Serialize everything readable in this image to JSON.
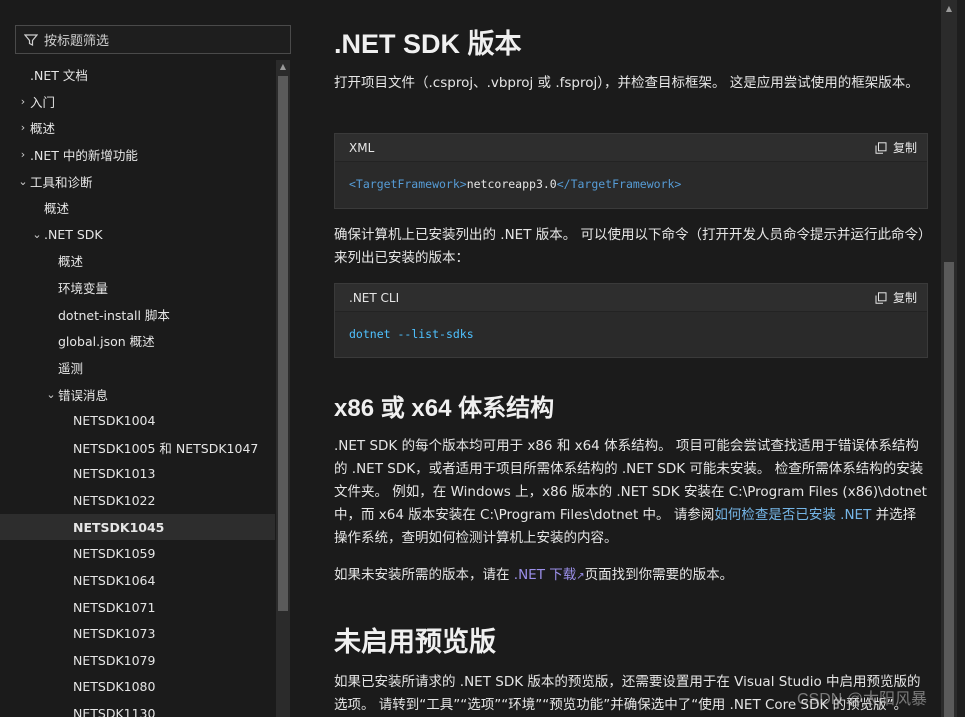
{
  "nav": {
    "filter_placeholder": "按标题筛选",
    "items": [
      {
        "label": ".NET 文档",
        "chevron": ""
      },
      {
        "label": "入门",
        "chevron": "›"
      },
      {
        "label": "概述",
        "chevron": "›"
      },
      {
        "label": ".NET 中的新增功能",
        "chevron": "›"
      },
      {
        "label": "工具和诊断",
        "chevron": "⌄"
      },
      {
        "label": "概述",
        "chevron": ""
      },
      {
        "label": ".NET SDK",
        "chevron": "⌄"
      },
      {
        "label": "概述",
        "chevron": ""
      },
      {
        "label": "环境变量",
        "chevron": ""
      },
      {
        "label": "dotnet-install 脚本",
        "chevron": ""
      },
      {
        "label": "global.json 概述",
        "chevron": ""
      },
      {
        "label": "遥测",
        "chevron": ""
      },
      {
        "label": "错误消息",
        "chevron": "⌄"
      },
      {
        "label": "NETSDK1004",
        "chevron": ""
      },
      {
        "label": "NETSDK1005 和 NETSDK1047",
        "chevron": ""
      },
      {
        "label": "NETSDK1013",
        "chevron": ""
      },
      {
        "label": "NETSDK1022",
        "chevron": ""
      },
      {
        "label": "NETSDK1045",
        "chevron": ""
      },
      {
        "label": "NETSDK1059",
        "chevron": ""
      },
      {
        "label": "NETSDK1064",
        "chevron": ""
      },
      {
        "label": "NETSDK1071",
        "chevron": ""
      },
      {
        "label": "NETSDK1073",
        "chevron": ""
      },
      {
        "label": "NETSDK1079",
        "chevron": ""
      },
      {
        "label": "NETSDK1080",
        "chevron": ""
      },
      {
        "label": "NETSDK1130",
        "chevron": ""
      }
    ]
  },
  "content": {
    "h_sdk": ".NET SDK 版本",
    "p1": "打开项目文件（.csproj、.vbproj 或 .fsproj），并检查目标框架。 这是应用尝试使用的框架版本。",
    "code1": {
      "lang": "XML",
      "copy": "复制",
      "open_tag": "<TargetFramework>",
      "value": "netcoreapp3.0",
      "close_tag": "</TargetFramework>"
    },
    "p2": "确保计算机上已安装列出的 .NET 版本。 可以使用以下命令（打开开发人员命令提示并运行此命令）来列出已安装的版本：",
    "code2": {
      "lang": ".NET CLI",
      "copy": "复制",
      "cmd": "dotnet",
      "arg": "--list-sdks"
    },
    "h_arch": "x86 或 x64 体系结构",
    "p3_pre": ".NET SDK 的每个版本均可用于 x86 和 x64 体系结构。 项目可能会尝试查找适用于错误体系结构的 .NET SDK，或者适用于项目所需体系结构的 .NET SDK 可能未安装。 检查所需体系结构的安装文件夹。 例如，在 Windows 上，x86 版本的 .NET SDK 安装在 C:\\Program Files (x86)\\dotnet 中，而 x64 版本安装在 C:\\Program Files\\dotnet 中。 请参阅",
    "p3_link": "如何检查是否已安装 .NET",
    "p3_post": " 并选择操作系统，查明如何检测计算机上安装的内容。",
    "p4_pre": "如果未安装所需的版本，请在 ",
    "p4_link": ".NET 下载",
    "p4_post": "页面找到你需要的版本。",
    "h_preview": "未启用预览版",
    "p5": "如果已安装所请求的 .NET SDK 版本的预览版，还需要设置用于在 Visual Studio 中启用预览版的选项。 请转到“工具”“选项”“环境”“预览功能”并确保选中了“使用 .NET Core SDK 的预览版”。"
  },
  "watermark": "CSDN @太阳风暴",
  "colors": {
    "background": "#1b1b1b",
    "link": "#75b6e7",
    "external_link": "#9b8fe9",
    "xml_tag": "#569cd6",
    "cli_keyword": "#4fc1ff"
  }
}
